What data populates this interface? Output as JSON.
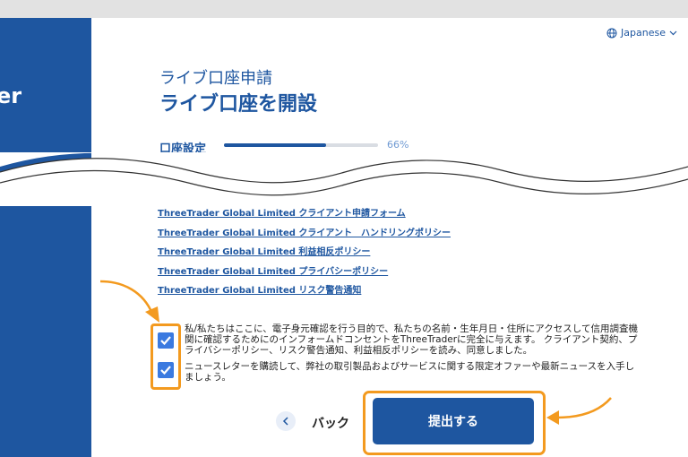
{
  "brand": {
    "text": "er"
  },
  "language": {
    "label": "Japanese"
  },
  "header": {
    "subtitle": "ライブ口座申請",
    "title": "ライブ口座を開設"
  },
  "progress": {
    "label": "口座設定",
    "percent_text": "66%",
    "value": 0.66
  },
  "links": [
    "ThreeTrader Global Limited クライアント申請フォーム",
    "ThreeTrader Global Limited クライアント　ハンドリングポリシー",
    "ThreeTrader Global Limited 利益相反ポリシー",
    "ThreeTrader Global Limited プライバシーポリシー",
    "ThreeTrader Global Limited リスク警告通知"
  ],
  "consent": {
    "consent_text": "私/私たちはここに、電子身元確認を行う目的で、私たちの名前・生年月日・住所にアクセスして信用調査機関に確認するためにのインフォームドコンセントをThreeTraderに完全に与えます。 クライアント契約、プライバシーポリシー、リスク警告通知、利益相反ポリシーを読み、同意しました。",
    "newsletter_text": "ニュースレターを購読して、弊社の取引製品およびサービスに関する限定オファーや最新ニュースを入手しましょう。"
  },
  "actions": {
    "back_label": "バック",
    "submit_label": "提出する"
  },
  "colors": {
    "brand_blue": "#1e56a0",
    "highlight_orange": "#f39a1f",
    "checkbox_blue": "#3b7ae0"
  }
}
